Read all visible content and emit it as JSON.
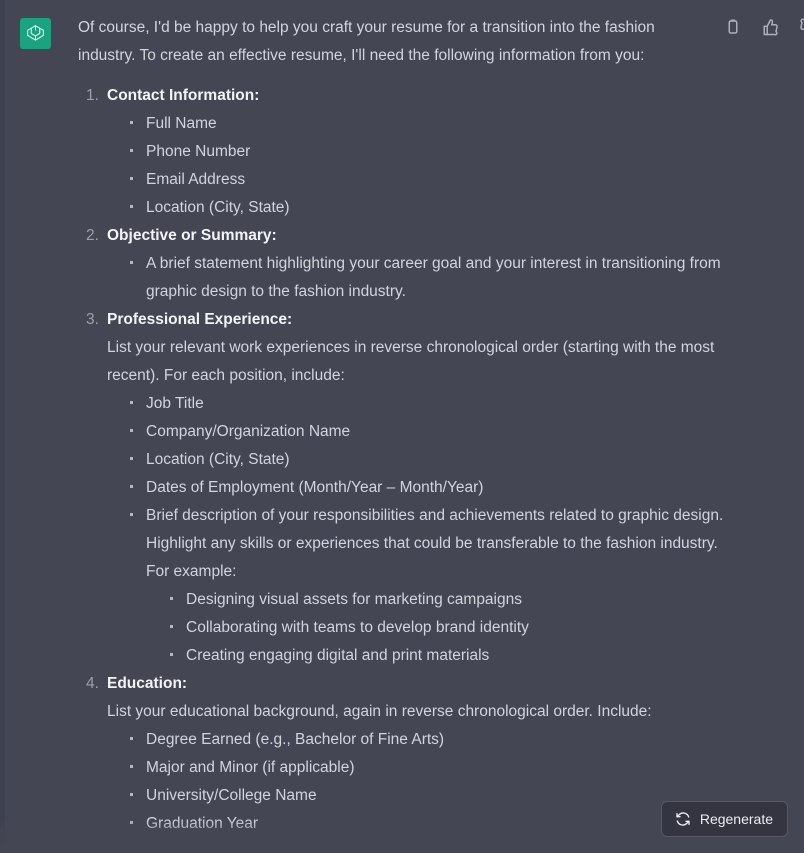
{
  "assistant": {
    "avatar_icon": "openai-logo-icon",
    "brand_color": "#19a37e"
  },
  "actions": [
    {
      "name": "copy-icon",
      "label": "Copy"
    },
    {
      "name": "thumbs-up-icon",
      "label": "Good response"
    },
    {
      "name": "thumbs-down-icon",
      "label": "Bad response"
    }
  ],
  "message": {
    "intro": "Of course, I'd be happy to help you craft your resume for a transition into the fashion industry. To create an effective resume, I'll need the following information from you:",
    "sections": [
      {
        "number": "1.",
        "title": "Contact Information:",
        "intro": "",
        "bullets": [
          "Full Name",
          "Phone Number",
          "Email Address",
          "Location (City, State)"
        ]
      },
      {
        "number": "2.",
        "title": "Objective or Summary:",
        "intro": "",
        "bullets": [
          "A brief statement highlighting your career goal and your interest in transitioning from graphic design to the fashion industry."
        ]
      },
      {
        "number": "3.",
        "title": "Professional Experience:",
        "intro": "List your relevant work experiences in reverse chronological order (starting with the most recent). For each position, include:",
        "bullets": [
          "Job Title",
          "Company/Organization Name",
          "Location (City, State)",
          "Dates of Employment (Month/Year – Month/Year)",
          "Brief description of your responsibilities and achievements related to graphic design. Highlight any skills or experiences that could be transferable to the fashion industry. For example:"
        ],
        "sub_bullets": [
          "Designing visual assets for marketing campaigns",
          "Collaborating with teams to develop brand identity",
          "Creating engaging digital and print materials"
        ]
      },
      {
        "number": "4.",
        "title": "Education:",
        "intro": "List your educational background, again in reverse chronological order. Include:",
        "bullets": [
          "Degree Earned (e.g., Bachelor of Fine Arts)",
          "Major and Minor (if applicable)",
          "University/College Name",
          "Graduation Year"
        ]
      }
    ]
  },
  "regenerate": {
    "label": "Regenerate",
    "icon": "refresh-icon"
  },
  "colors": {
    "background": "#444654",
    "text": "#d1d5db",
    "heading": "#f3f4f6",
    "marker": "#9ca0ad",
    "button_bg": "#343541",
    "button_border": "#565869"
  }
}
